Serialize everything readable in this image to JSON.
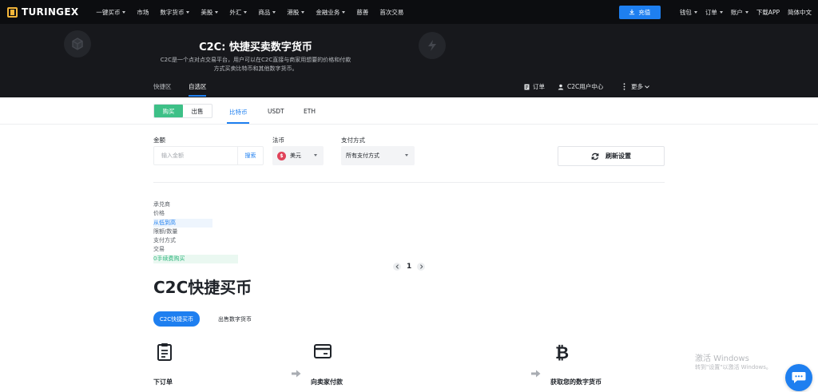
{
  "brand": {
    "name": "TURINGEX",
    "accent": "#1e7ff0",
    "buy_color": "#3dc087"
  },
  "topnav": {
    "items": [
      {
        "label": "一键买币",
        "dropdown": true
      },
      {
        "label": "市场",
        "dropdown": false
      },
      {
        "label": "数字货币",
        "dropdown": true
      },
      {
        "label": "美股",
        "dropdown": true
      },
      {
        "label": "外汇",
        "dropdown": true
      },
      {
        "label": "商品",
        "dropdown": true
      },
      {
        "label": "港股",
        "dropdown": true
      },
      {
        "label": "金融业务",
        "dropdown": true
      },
      {
        "label": "慈善",
        "dropdown": false
      },
      {
        "label": "首次交易",
        "dropdown": false
      }
    ],
    "deposit_label": "充值",
    "right": [
      {
        "label": "钱包",
        "dropdown": true
      },
      {
        "label": "订单",
        "dropdown": true
      },
      {
        "label": "账户",
        "dropdown": true
      },
      {
        "label": "下载APP",
        "dropdown": false
      },
      {
        "label": "简体中文",
        "dropdown": false
      }
    ]
  },
  "hero": {
    "title": "C2C: 快捷买卖数字货币",
    "desc": "C2C是一个点对点交易平台，用户可以在C2C直接与商家用想要的价格和付款方式买卖比特币和其他数字货币。",
    "tabs": [
      "快捷区",
      "自选区"
    ],
    "active_tab": 1,
    "orders_label": "订单",
    "c2c_user_center": "C2C用户中心",
    "more_label": "更多"
  },
  "trade": {
    "buy_label": "购买",
    "sell_label": "出售",
    "coins": [
      "比特币",
      "USDT",
      "ETH"
    ],
    "active_coin": 0
  },
  "filters": {
    "amount_label": "金额",
    "amount_placeholder": "输入金额",
    "amount_value": "",
    "search_label": "搜索",
    "fiat_label": "法币",
    "fiat_value": "美元",
    "payment_label": "支付方式",
    "payment_value": "所有支付方式",
    "refresh_label": "刷新设置"
  },
  "table_headers": {
    "merchant": "承兑商",
    "price": "价格",
    "sort": "从低到高",
    "limit": "限额/数量",
    "payment": "支付方式",
    "trade": "交易",
    "promo": "0手续费购买"
  },
  "pagination": {
    "current": "1"
  },
  "quick_buy": {
    "title": "C2C快捷买币",
    "tabs": [
      "C2C快捷买币",
      "出售数字货币"
    ],
    "steps": [
      "下订单",
      "向卖家付款",
      "获取您的数字货币"
    ]
  },
  "watermark": {
    "line1": "激活 Windows",
    "line2": "转到\"设置\"以激活 Windows。"
  }
}
